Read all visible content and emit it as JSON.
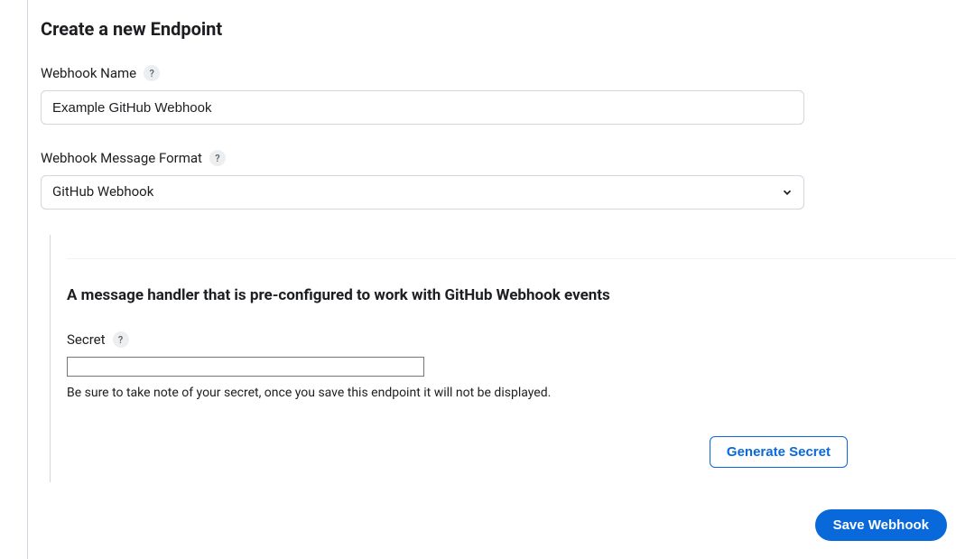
{
  "page": {
    "title": "Create a new Endpoint"
  },
  "form": {
    "webhook_name": {
      "label": "Webhook Name",
      "value": "Example GitHub Webhook"
    },
    "message_format": {
      "label": "Webhook Message Format",
      "selected": "GitHub Webhook"
    }
  },
  "handler": {
    "title": "A message handler that is pre-configured to work with GitHub Webhook events",
    "secret": {
      "label": "Secret",
      "value": "",
      "note": "Be sure to take note of your secret, once you save this endpoint it will not be displayed."
    },
    "generate_button": "Generate Secret"
  },
  "actions": {
    "save": "Save Webhook"
  },
  "icons": {
    "help": "?"
  }
}
